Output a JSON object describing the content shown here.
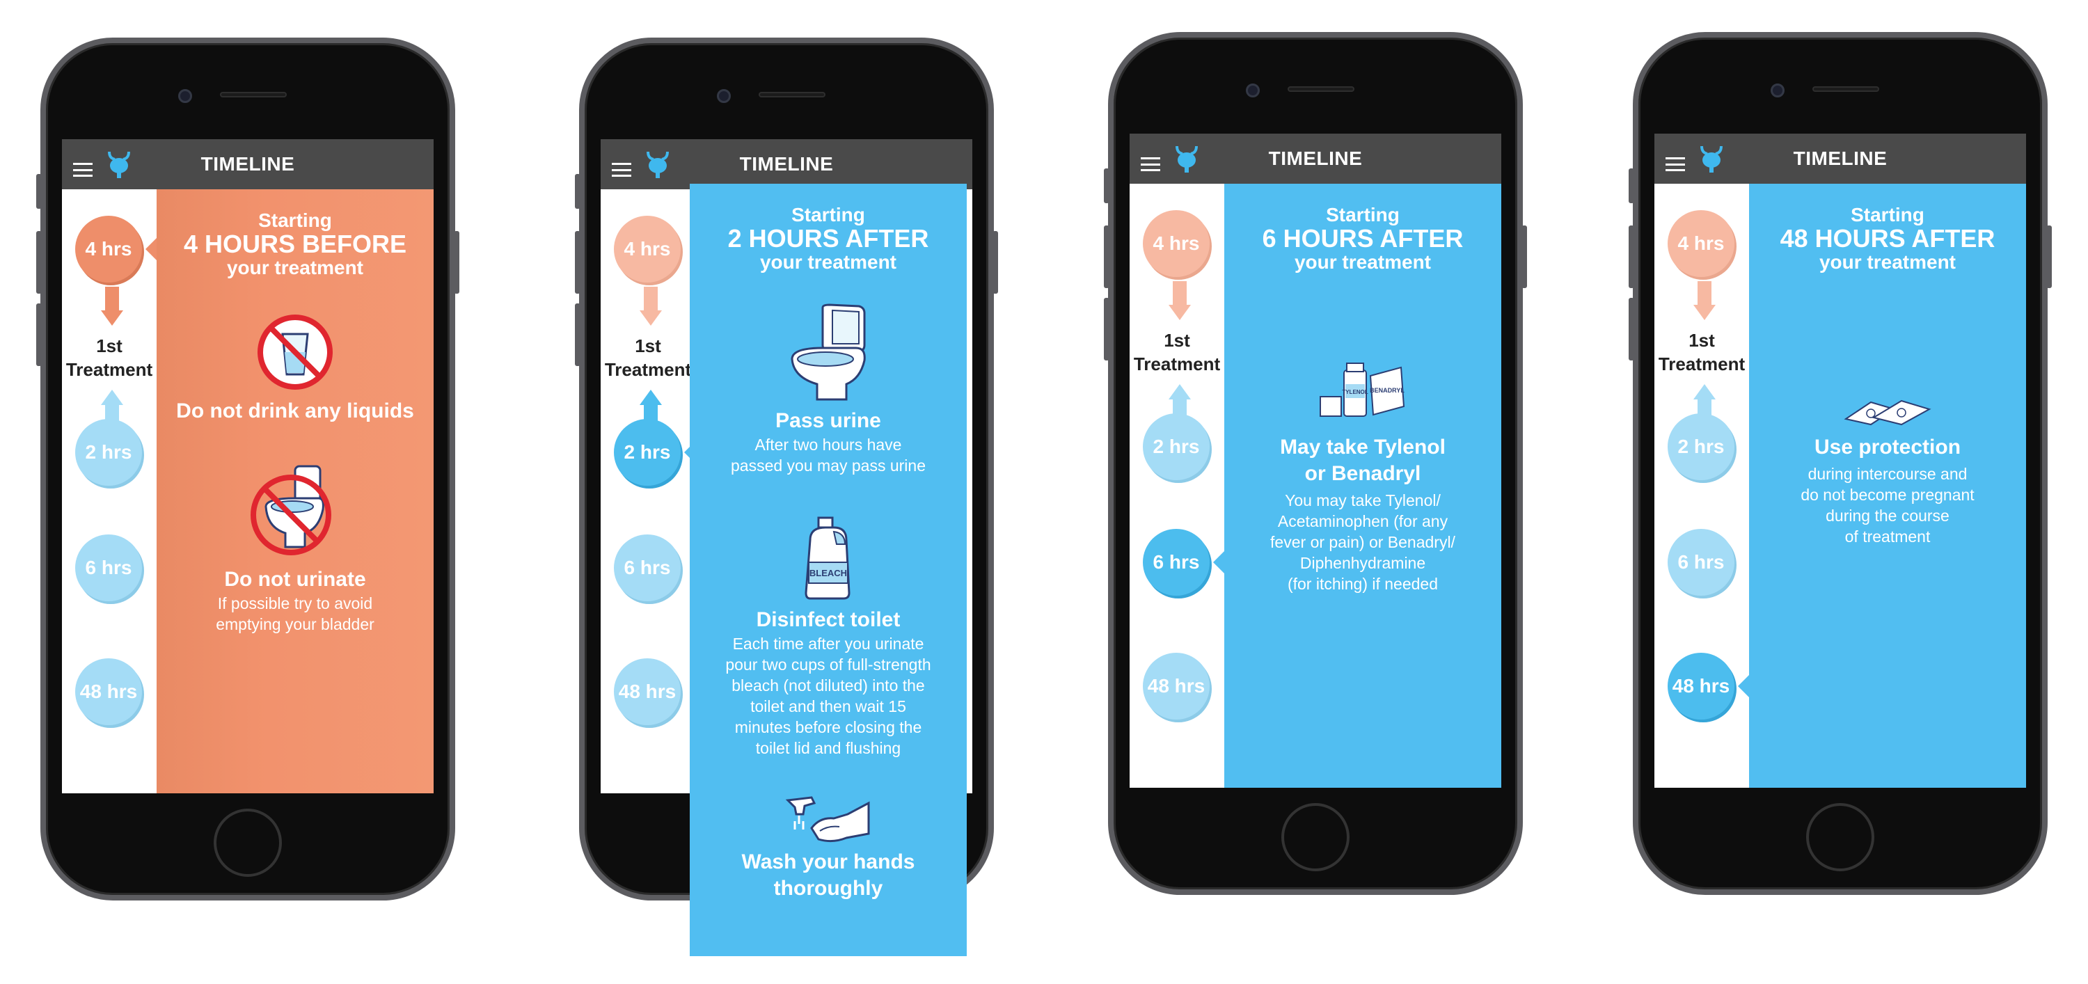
{
  "app": {
    "header_title": "TIMELINE",
    "logo_icon": "bladder-icon",
    "menu_icon": "hamburger-menu-icon"
  },
  "colors": {
    "orange": "#ef8f69",
    "blue": "#51bef1",
    "peach": "#f7b9a2",
    "light_blue": "#a4dcf6",
    "header": "#4a4a4a"
  },
  "sidebar": {
    "hrs_4": "4 hrs",
    "treatment_line1": "1st",
    "treatment_line2": "Treatment",
    "hrs_2": "2 hrs",
    "hrs_6": "6 hrs",
    "hrs_48": "48 hrs"
  },
  "screens": [
    {
      "starting": "Starting",
      "headline": "4 HOURS BEFORE",
      "your_treatment": "your treatment",
      "items": [
        {
          "icon": "no-drinking-glass-icon",
          "label": "Do not drink any liquids",
          "desc": ""
        },
        {
          "icon": "no-toilet-icon",
          "label": "Do not urinate",
          "desc_lines": [
            "If possible try to avoid",
            "emptying your bladder"
          ]
        }
      ]
    },
    {
      "starting": "Starting",
      "headline": "2 HOURS AFTER",
      "your_treatment": "your treatment",
      "items": [
        {
          "icon": "toilet-icon",
          "label": "Pass urine",
          "desc_lines": [
            "After two hours have",
            "passed you may pass urine"
          ]
        },
        {
          "icon": "bleach-bottle-icon",
          "bleach_text": "BLEACH",
          "label": "Disinfect toilet",
          "desc_lines": [
            "Each time after you urinate",
            "pour two cups of full-strength",
            "bleach (not diluted) into the",
            "toilet and then wait 15",
            "minutes before closing the",
            "toilet lid and flushing"
          ]
        },
        {
          "icon": "hand-washing-icon",
          "label_lines": [
            "Wash your hands",
            "thoroughly"
          ]
        }
      ]
    },
    {
      "starting": "Starting",
      "headline": "6 HOURS AFTER",
      "your_treatment": "your treatment",
      "items": [
        {
          "icon": "medicine-bottles-icon",
          "tylenol_text": "TYLENOL",
          "benadryl_text": "BENADRYL",
          "label_lines": [
            "May take Tylenol",
            "or Benadryl"
          ],
          "desc_lines": [
            "You may take Tylenol/",
            "Acetaminophen (for any",
            "fever or pain) or Benadryl/",
            "Diphenhydramine",
            "(for itching) if needed"
          ]
        }
      ]
    },
    {
      "starting": "Starting",
      "headline": "48 HOURS AFTER",
      "your_treatment": "your treatment",
      "items": [
        {
          "icon": "condom-packets-icon",
          "label": "Use protection",
          "desc_lines": [
            "during intercourse and",
            "do not become pregnant",
            "during the course",
            "of treatment"
          ]
        }
      ]
    }
  ]
}
